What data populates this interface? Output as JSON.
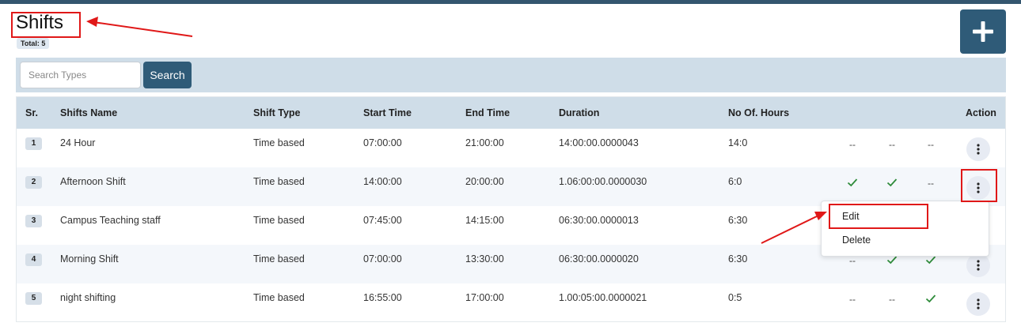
{
  "page": {
    "title": "Shifts",
    "total_label": "Total: 5",
    "add_icon": "plus-icon"
  },
  "search": {
    "placeholder": "Search Types",
    "value": "",
    "button_label": "Search"
  },
  "table": {
    "columns": [
      "Sr.",
      "Shifts Name",
      "Shift Type",
      "Start Time",
      "End Time",
      "Duration",
      "No Of. Hours",
      "Action"
    ],
    "rows": [
      {
        "sr": "1",
        "name": "24 Hour",
        "type": "Time based",
        "start": "07:00:00",
        "end": "21:00:00",
        "duration": "14:00:00.0000043",
        "hours": "14:0",
        "f1": "--",
        "f2": "--",
        "f3": "--"
      },
      {
        "sr": "2",
        "name": "Afternoon Shift",
        "type": "Time based",
        "start": "14:00:00",
        "end": "20:00:00",
        "duration": "1.06:00:00.0000030",
        "hours": "6:0",
        "f1": "check",
        "f2": "check",
        "f3": "--"
      },
      {
        "sr": "3",
        "name": "Campus Teaching staff",
        "type": "Time based",
        "start": "07:45:00",
        "end": "14:15:00",
        "duration": "06:30:00.0000013",
        "hours": "6:30",
        "f1": "",
        "f2": "",
        "f3": ""
      },
      {
        "sr": "4",
        "name": "Morning Shift",
        "type": "Time based",
        "start": "07:00:00",
        "end": "13:30:00",
        "duration": "06:30:00.0000020",
        "hours": "6:30",
        "f1": "--",
        "f2": "check",
        "f3": "check"
      },
      {
        "sr": "5",
        "name": "night shifting",
        "type": "Time based",
        "start": "16:55:00",
        "end": "17:00:00",
        "duration": "1.00:05:00.0000021",
        "hours": "0:5",
        "f1": "--",
        "f2": "--",
        "f3": "check"
      }
    ]
  },
  "menu": {
    "edit_label": "Edit",
    "delete_label": "Delete"
  },
  "colors": {
    "primary": "#2f5b78",
    "header_bg": "#cfdde8",
    "check": "#2e8b3a",
    "annotation": "#e01818"
  }
}
